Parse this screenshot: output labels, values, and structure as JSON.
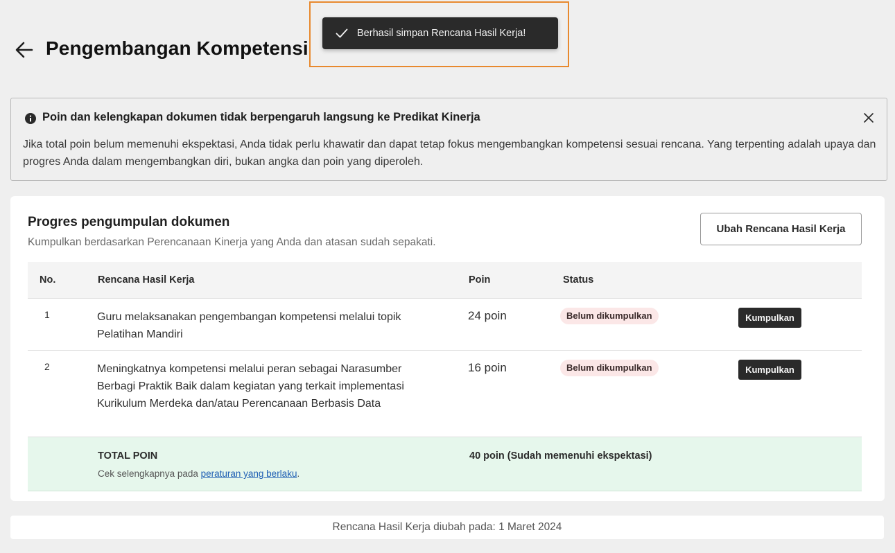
{
  "header": {
    "title": "Pengembangan Kompetensi",
    "back_icon": "arrow-left-icon"
  },
  "toast": {
    "message": "Berhasil simpan Rencana Hasil Kerja!",
    "icon": "check-icon",
    "highlight_color": "#e8892e"
  },
  "alert": {
    "title": "Poin dan kelengkapan dokumen tidak berpengaruh langsung ke Predikat Kinerja",
    "body": "Jika total poin belum memenuhi ekspektasi, Anda tidak perlu khawatir dan dapat tetap fokus mengembangkan kompetensi sesuai rencana. Yang terpenting adalah upaya dan progres Anda dalam mengembangkan diri, bukan angka dan poin yang diperoleh.",
    "icon": "info-icon",
    "close_icon": "close-icon"
  },
  "progress": {
    "title": "Progres pengumpulan dokumen",
    "subtitle": "Kumpulkan berdasarkan Perencanaan Kinerja yang Anda dan atasan sudah sepakati.",
    "edit_button": "Ubah Rencana Hasil Kerja",
    "columns": {
      "no": "No.",
      "plan": "Rencana Hasil Kerja",
      "poin": "Poin",
      "status": "Status"
    },
    "rows": [
      {
        "no": "1",
        "plan": "Guru melaksanakan pengembangan kompetensi melalui topik Pelatihan Mandiri",
        "poin": "24 poin",
        "status": "Belum dikumpulkan",
        "action": "Kumpulkan"
      },
      {
        "no": "2",
        "plan": "Meningkatnya kompetensi melalui peran sebagai Narasumber Berbagi Praktik Baik dalam kegiatan yang terkait implementasi Kurikulum Merdeka dan/atau Perencanaan Berbasis Data",
        "poin": "16 poin",
        "status": "Belum dikumpulkan",
        "action": "Kumpulkan"
      }
    ],
    "total": {
      "label": "TOTAL POIN",
      "note_prefix": "Cek selengkapnya pada ",
      "note_link": "peraturan yang berlaku",
      "note_suffix": ".",
      "value": "40 poin (Sudah memenuhi ekspektasi)",
      "background": "#e6f7ec"
    }
  },
  "footer": {
    "text": "Rencana Hasil Kerja diubah pada: 1 Maret 2024"
  },
  "colors": {
    "page_background": "#efefef",
    "badge_background": "#fbe7e7",
    "button_dark": "#2a2a2a",
    "link": "#1f5fb4"
  }
}
